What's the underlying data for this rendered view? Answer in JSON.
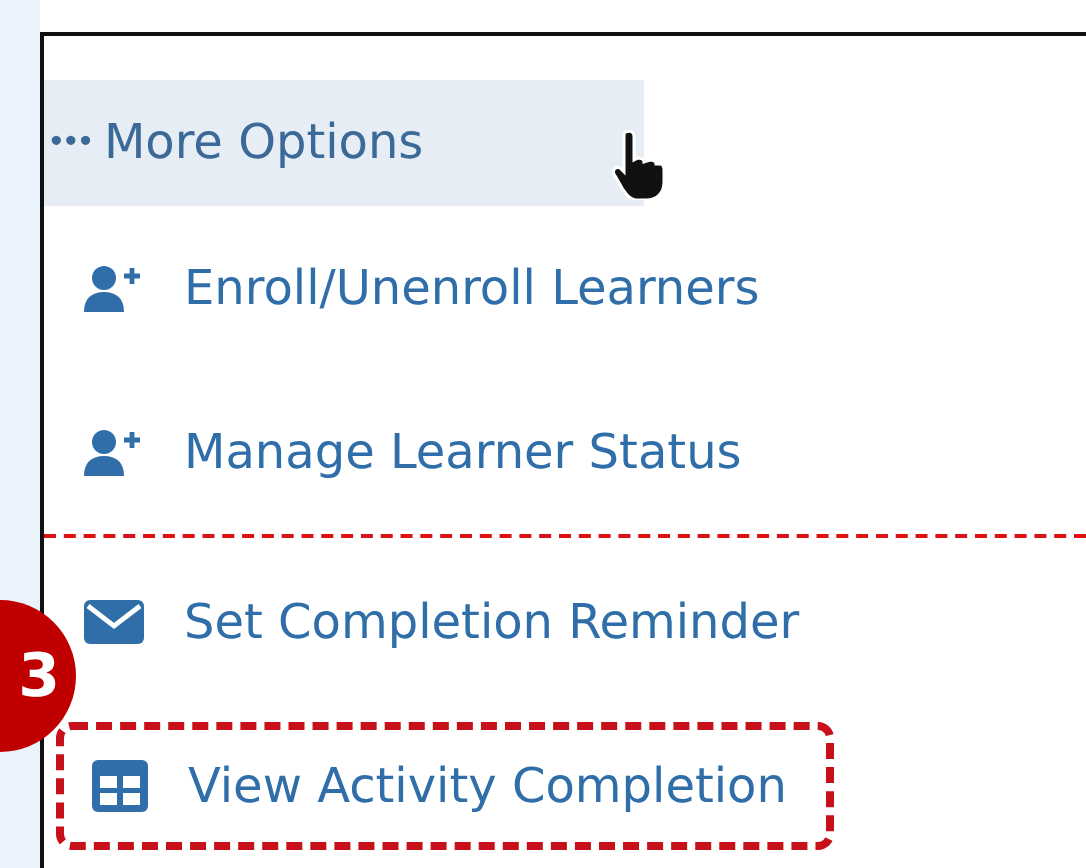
{
  "more_options": {
    "icon": "•••",
    "label": "More Options",
    "hovered": true
  },
  "items": [
    {
      "kind": "user-add",
      "label": "Enroll/Unenroll Learners",
      "highlighted": false,
      "separator_after": false
    },
    {
      "kind": "user-add",
      "label": "Manage Learner Status",
      "highlighted": false,
      "separator_after": true
    },
    {
      "kind": "mail",
      "label": "Set Completion Reminder",
      "highlighted": false,
      "separator_after": false
    },
    {
      "kind": "table",
      "label": "View Activity Completion",
      "highlighted": true,
      "separator_after": false
    }
  ],
  "callout": {
    "number": "3"
  }
}
